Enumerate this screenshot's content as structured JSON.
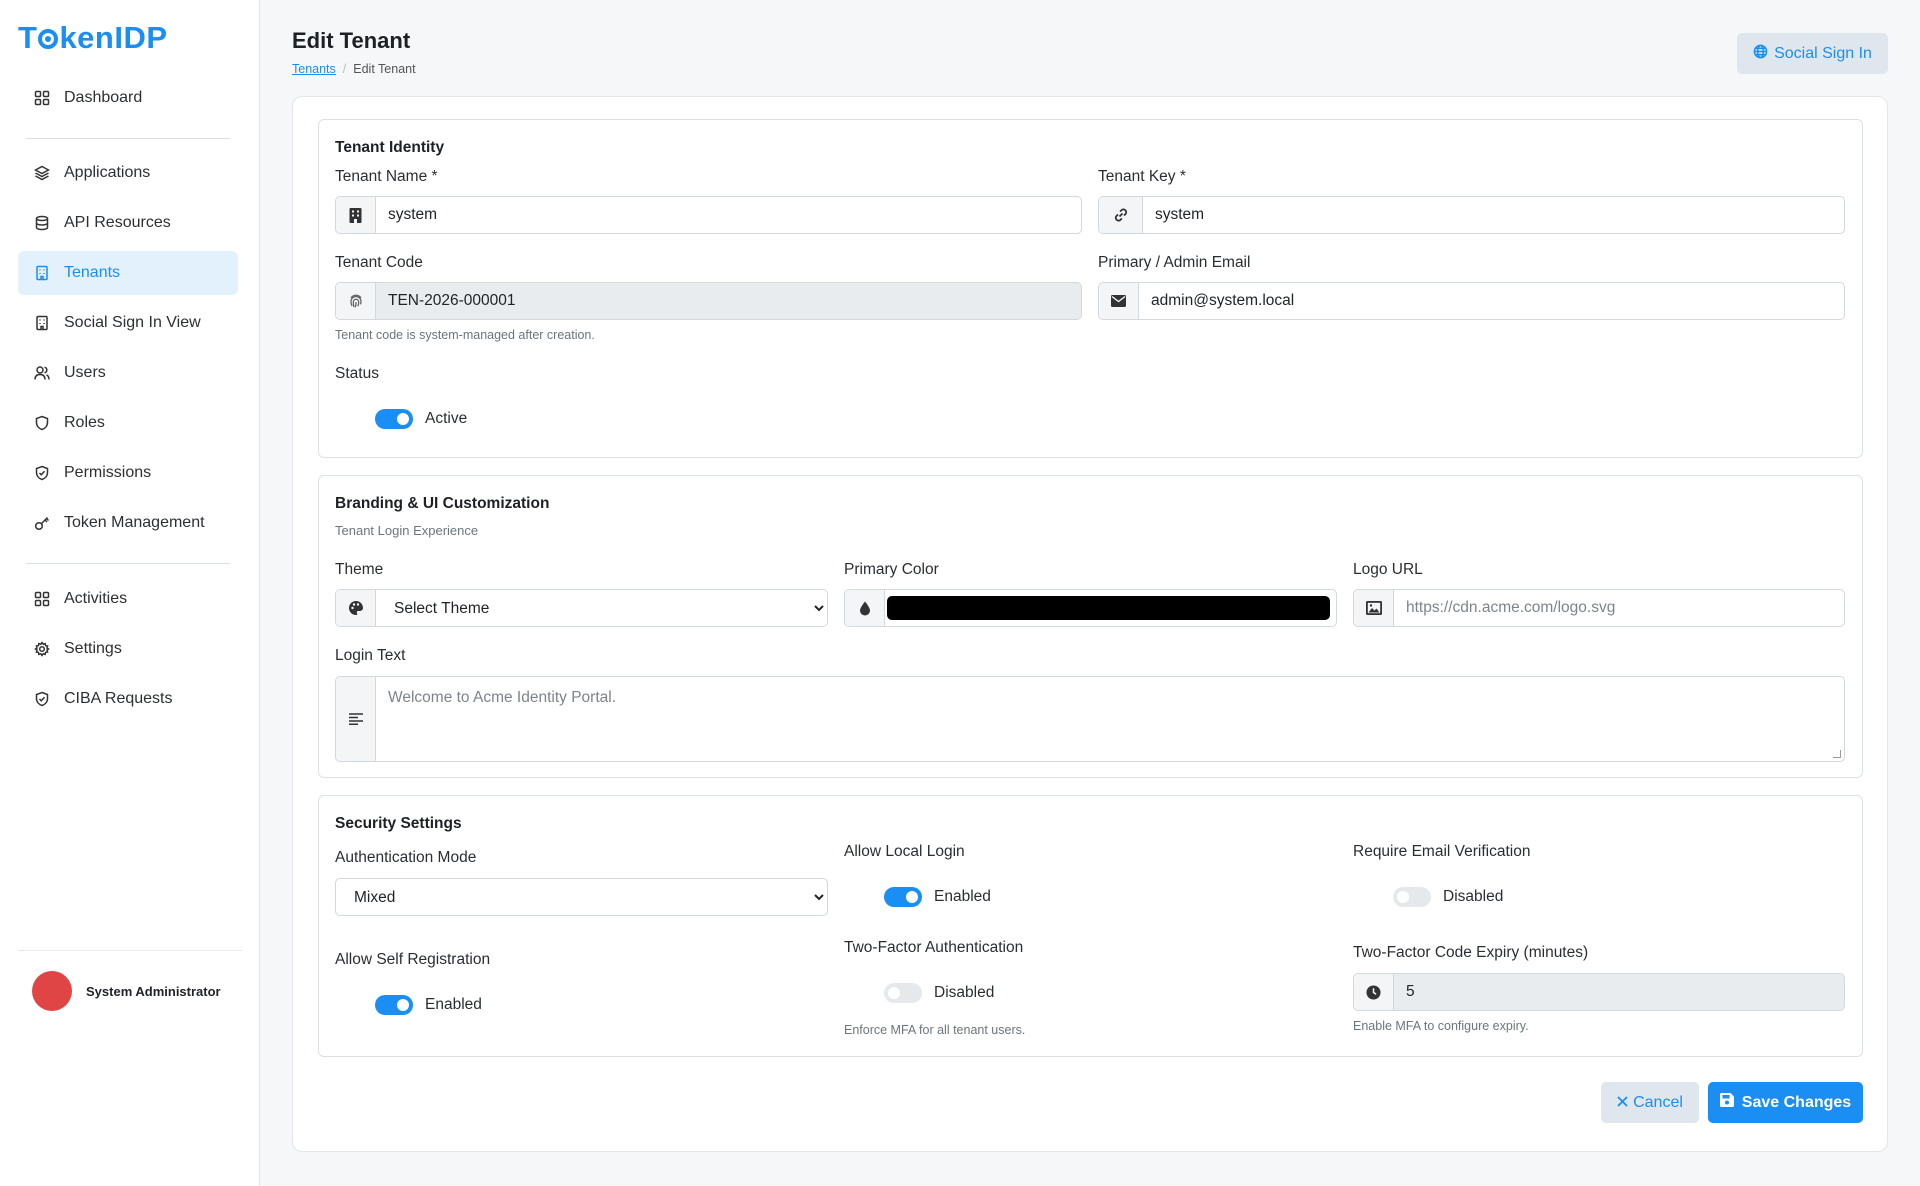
{
  "app": {
    "logo": "TokenIDP"
  },
  "sidebar": {
    "items": [
      {
        "label": "Dashboard",
        "icon": "grid-icon"
      },
      {
        "label": "Applications",
        "icon": "layers-icon"
      },
      {
        "label": "API Resources",
        "icon": "database-icon"
      },
      {
        "label": "Tenants",
        "icon": "building-icon",
        "active": true
      },
      {
        "label": "Social Sign In View",
        "icon": "building-icon"
      },
      {
        "label": "Users",
        "icon": "users-icon"
      },
      {
        "label": "Roles",
        "icon": "shield-icon"
      },
      {
        "label": "Permissions",
        "icon": "shield-check-icon"
      },
      {
        "label": "Token Management",
        "icon": "key-icon"
      },
      {
        "label": "Activities",
        "icon": "grid-icon"
      },
      {
        "label": "Settings",
        "icon": "gear-icon"
      },
      {
        "label": "CIBA Requests",
        "icon": "shield-check-icon"
      }
    ],
    "user": {
      "name": "System Administrator",
      "avatar_color": "#e04545"
    }
  },
  "header": {
    "title": "Edit Tenant",
    "breadcrumb": {
      "link": "Tenants",
      "current": "Edit Tenant"
    },
    "social_button": "Social Sign In"
  },
  "identity": {
    "title": "Tenant Identity",
    "tenant_name": {
      "label": "Tenant Name *",
      "value": "system"
    },
    "tenant_key": {
      "label": "Tenant Key *",
      "value": "system"
    },
    "tenant_code": {
      "label": "Tenant Code",
      "value": "TEN-2026-000001",
      "help": "Tenant code is system-managed after creation."
    },
    "admin_email": {
      "label": "Primary / Admin Email",
      "value": "admin@system.local"
    },
    "status": {
      "label": "Status",
      "toggle": "Active",
      "on": true
    }
  },
  "branding": {
    "title": "Branding & UI Customization",
    "subtitle": "Tenant Login Experience",
    "theme": {
      "label": "Theme",
      "value": "Select Theme"
    },
    "primary_color": {
      "label": "Primary Color",
      "value": "#000000"
    },
    "logo_url": {
      "label": "Logo URL",
      "placeholder": "https://cdn.acme.com/logo.svg"
    },
    "login_text": {
      "label": "Login Text",
      "placeholder": "Welcome to Acme Identity Portal."
    }
  },
  "security": {
    "title": "Security Settings",
    "auth_mode": {
      "label": "Authentication Mode",
      "value": "Mixed"
    },
    "allow_local_login": {
      "label": "Allow Local Login",
      "toggle": "Enabled",
      "on": true
    },
    "require_email_verification": {
      "label": "Require Email Verification",
      "toggle": "Disabled",
      "on": false
    },
    "allow_self_registration": {
      "label": "Allow Self Registration",
      "toggle": "Enabled",
      "on": true
    },
    "two_factor": {
      "label": "Two-Factor Authentication",
      "toggle": "Disabled",
      "on": false,
      "help": "Enforce MFA for all tenant users."
    },
    "two_factor_expiry": {
      "label": "Two-Factor Code Expiry (minutes)",
      "value": "5",
      "help": "Enable MFA to configure expiry."
    }
  },
  "actions": {
    "cancel": "Cancel",
    "save": "Save Changes"
  },
  "colors": {
    "accent": "#1a8ef2",
    "active_bg": "#e3f1fd"
  }
}
